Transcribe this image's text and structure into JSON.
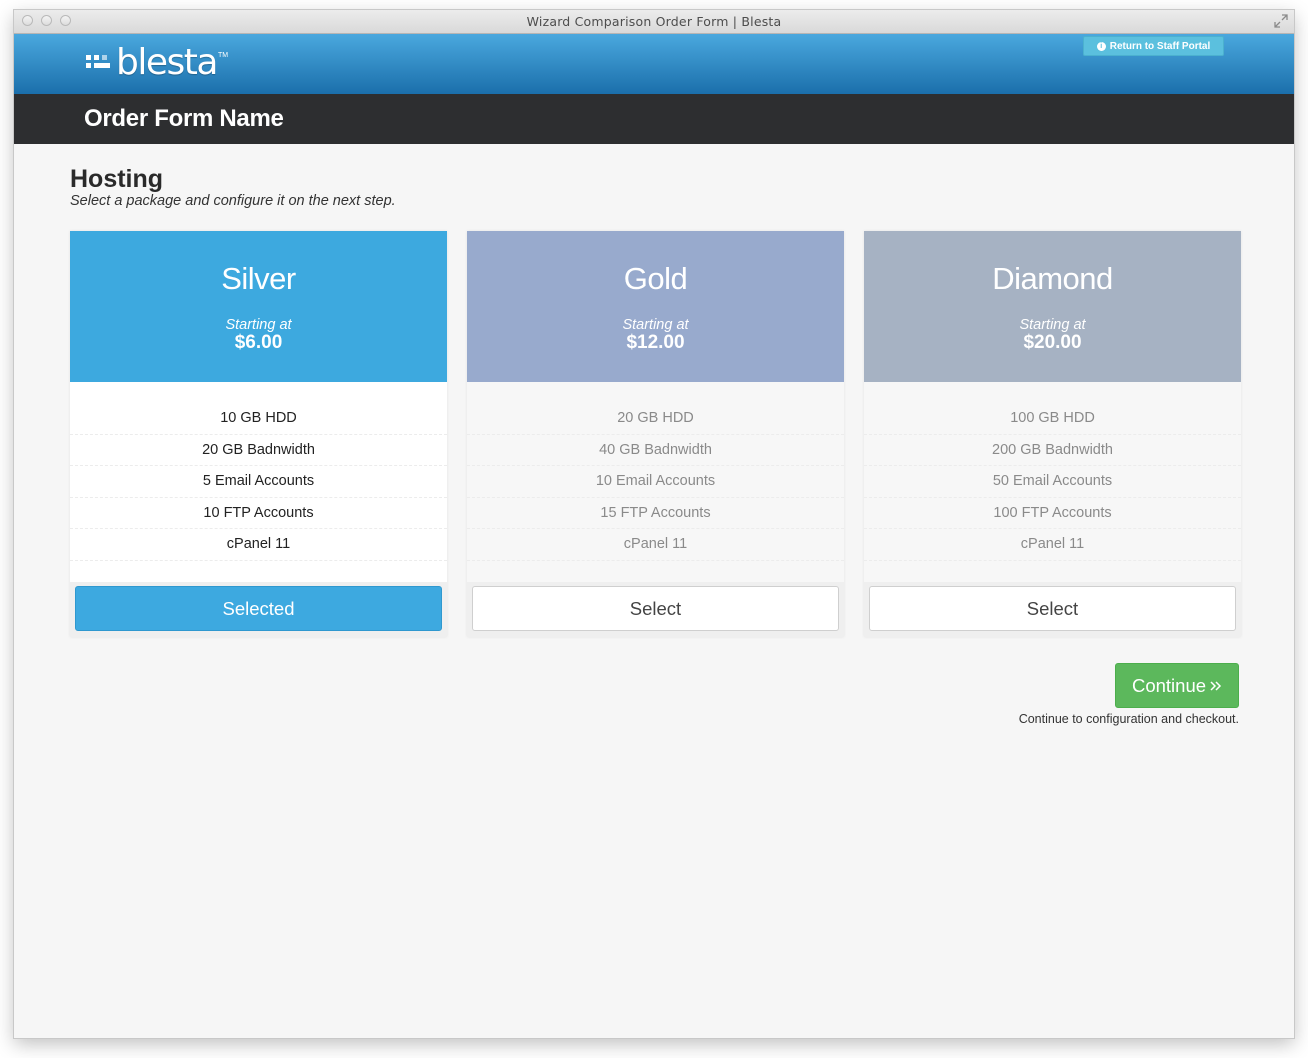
{
  "window": {
    "title": "Wizard Comparison Order Form | Blesta"
  },
  "header": {
    "logo_text": "blesta",
    "logo_tm": "TM",
    "staff_portal_label": "Return to Staff Portal"
  },
  "form": {
    "name": "Order Form Name"
  },
  "section": {
    "title": "Hosting",
    "subtitle": "Select a package and configure it on the next step."
  },
  "plans": [
    {
      "name": "Silver",
      "starting_label": "Starting at",
      "price": "$6.00",
      "features": [
        "10 GB HDD",
        "20 GB Badnwidth",
        "5 Email Accounts",
        "10 FTP Accounts",
        "cPanel 11"
      ],
      "button_label": "Selected",
      "color": "#3da9df",
      "selected": true
    },
    {
      "name": "Gold",
      "starting_label": "Starting at",
      "price": "$12.00",
      "features": [
        "20 GB HDD",
        "40 GB Badnwidth",
        "10 Email Accounts",
        "15 FTP Accounts",
        "cPanel 11"
      ],
      "button_label": "Select",
      "color": "#98aacd",
      "selected": false
    },
    {
      "name": "Diamond",
      "starting_label": "Starting at",
      "price": "$20.00",
      "features": [
        "100 GB HDD",
        "200 GB Badnwidth",
        "50 Email Accounts",
        "100 FTP Accounts",
        "cPanel 11"
      ],
      "button_label": "Select",
      "color": "#a6b2c3",
      "selected": false
    }
  ],
  "continue": {
    "label": "Continue",
    "icon": "double-chevron-right-icon",
    "note": "Continue to configuration and checkout."
  }
}
